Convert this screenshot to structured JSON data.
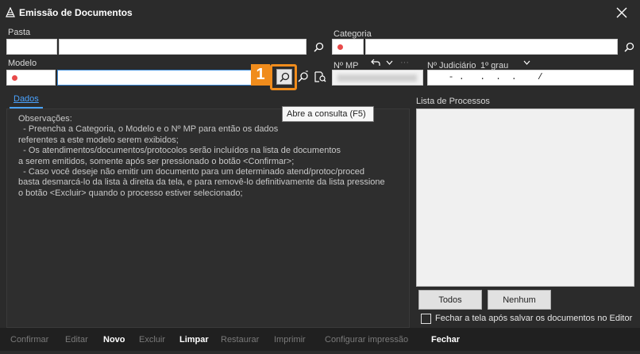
{
  "window": {
    "title": "Emissão de Documentos",
    "close_icon": "close-icon"
  },
  "form": {
    "pasta_label": "Pasta",
    "categoria_label": "Categoria",
    "modelo_label": "Modelo",
    "nmp_label": "Nº MP",
    "njud_label": "Nº Judiciário",
    "grau_label": "1º grau",
    "njud_value": "   - .   .  .  .    /",
    "undo_icon": "undo-arrow-icon",
    "more_icon": "ellipsis-icon"
  },
  "tabs": {
    "dados_label": "Dados"
  },
  "observations": [
    "Observações:",
    "  - Preencha a Categoria, o Modelo e o Nº MP para então os dados",
    "referentes a este modelo serem exibidos;",
    "  - Os atendimentos/documentos/protocolos serão incluídos na lista de documentos",
    "a serem emitidos, somente após ser pressionado o botão <Confirmar>;",
    "  - Caso você deseje não emitir um documento para um determinado atend/protoc/proced",
    "basta desmarcá-lo da lista à direita da tela, e para removê-lo definitivamente da lista pressione",
    "o botão <Excluir> quando o processo estiver selecionado;"
  ],
  "process_list": {
    "label": "Lista de Processos",
    "todos_label": "Todos",
    "nenhum_label": "Nenhum",
    "close_after_save_label": "Fechar a tela após salvar os documentos no Editor"
  },
  "toolbar": {
    "confirmar": "Confirmar",
    "editar": "Editar",
    "novo": "Novo",
    "excluir": "Excluir",
    "limpar": "Limpar",
    "restaurar": "Restaurar",
    "imprimir": "Imprimir",
    "configurar": "Configurar impressão",
    "fechar": "Fechar"
  },
  "tooltip": {
    "text": "Abre a consulta (F5)"
  },
  "annotation": {
    "number": "1",
    "color": "#f08c1c"
  }
}
